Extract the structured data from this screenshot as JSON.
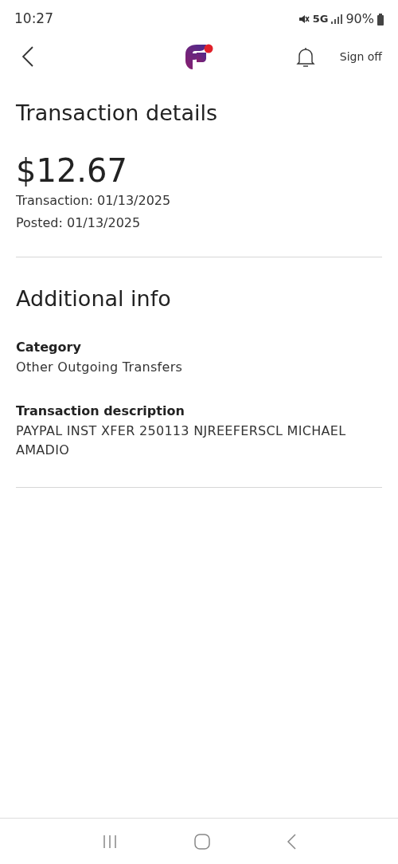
{
  "status_bar": {
    "time": "10:27",
    "network": "5G",
    "battery": "90%"
  },
  "header": {
    "sign_off": "Sign off"
  },
  "title": "Transaction details",
  "amount": "$12.67",
  "dates": [
    "Transaction: 01/13/2025",
    "Posted: 01/13/2025"
  ],
  "section_title": "Additional info",
  "fields": [
    {
      "label": "Category",
      "value": "Other Outgoing Transfers"
    },
    {
      "label": "Transaction description",
      "value": "PAYPAL INST XFER 250113 NJREEFERSCL MICHAEL AMADIO"
    }
  ]
}
